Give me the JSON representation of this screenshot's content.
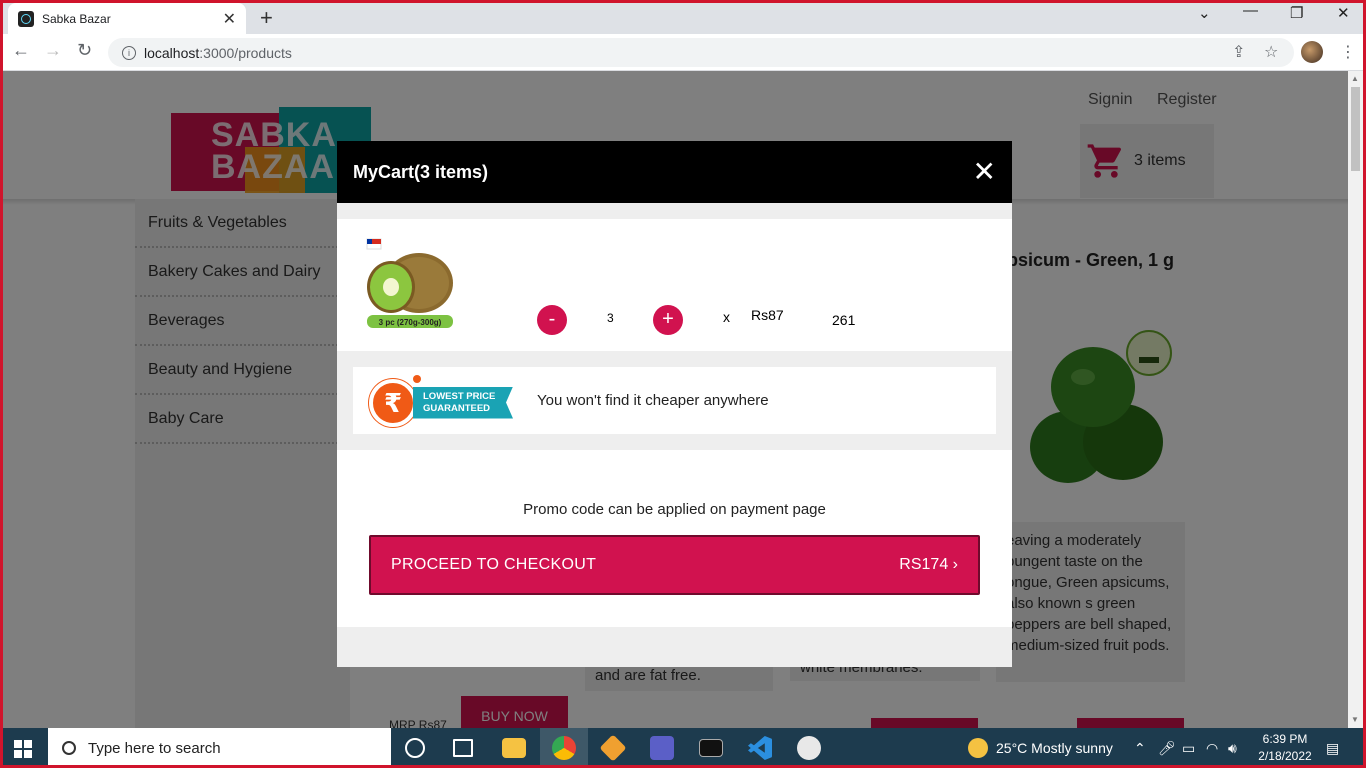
{
  "browser": {
    "tab_title": "Sabka Bazar",
    "url_host": "localhost",
    "url_path": ":3000/products"
  },
  "header": {
    "signin": "Signin",
    "register": "Register",
    "cart_count": "3 items",
    "logo_text_line1": "SABKA",
    "logo_text_line2": "BAZAAR"
  },
  "sidebar": {
    "items": [
      {
        "label": "Fruits & Vegetables"
      },
      {
        "label": "Bakery Cakes and Dairy"
      },
      {
        "label": "Beverages"
      },
      {
        "label": "Beauty and Hygiene"
      },
      {
        "label": "Baby Care"
      }
    ]
  },
  "background_products": {
    "product_title": "apsicum - Green, 1 g",
    "desc1": "and are fat free.",
    "desc2": "white membranes.",
    "desc3": "eaving a moderately pungent taste on the ongue, Green apsicums, also known s green peppers are bell shaped, medium-sized fruit pods.",
    "mrp": "MRP Rs87",
    "buy_now": "BUY NOW"
  },
  "cart_modal": {
    "title": "MyCart(3 items)",
    "close": "✕",
    "item": {
      "image_caption": "3 pc (270g-300g)",
      "decrement": "-",
      "quantity": "3",
      "increment": "+",
      "times": "x",
      "price": "Rs87",
      "subtotal": "261"
    },
    "banner": {
      "badge_symbol": "₹",
      "badge_line1": "LOWEST PRICE",
      "badge_line2": "GUARANTEED",
      "text": "You won't find it cheaper anywhere"
    },
    "promo_note": "Promo code can be applied on payment page",
    "checkout_label": "PROCEED TO CHECKOUT",
    "checkout_amount": "RS174 ›"
  },
  "taskbar": {
    "search_placeholder": "Type here to search",
    "weather": "25°C  Mostly sunny",
    "time": "6:39 PM",
    "date": "2/18/2022"
  },
  "colors": {
    "brand_pink": "#d1124f",
    "promo_orange": "#f05a16",
    "promo_teal": "#1aa3b4"
  }
}
